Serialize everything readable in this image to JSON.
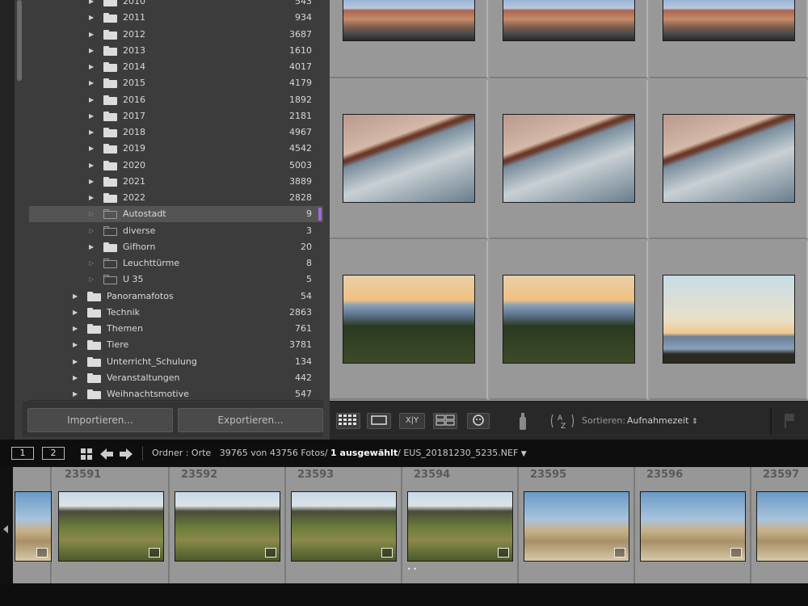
{
  "folder_panel": {
    "folders": [
      {
        "name": "2010",
        "count": "543",
        "level": 2,
        "expandable": true,
        "filled": true
      },
      {
        "name": "2011",
        "count": "934",
        "level": 2,
        "expandable": true,
        "filled": true
      },
      {
        "name": "2012",
        "count": "3687",
        "level": 2,
        "expandable": true,
        "filled": true
      },
      {
        "name": "2013",
        "count": "1610",
        "level": 2,
        "expandable": true,
        "filled": true
      },
      {
        "name": "2014",
        "count": "4017",
        "level": 2,
        "expandable": true,
        "filled": true
      },
      {
        "name": "2015",
        "count": "4179",
        "level": 2,
        "expandable": true,
        "filled": true
      },
      {
        "name": "2016",
        "count": "1892",
        "level": 2,
        "expandable": true,
        "filled": true
      },
      {
        "name": "2017",
        "count": "2181",
        "level": 2,
        "expandable": true,
        "filled": true
      },
      {
        "name": "2018",
        "count": "4967",
        "level": 2,
        "expandable": true,
        "filled": true
      },
      {
        "name": "2019",
        "count": "4542",
        "level": 2,
        "expandable": true,
        "filled": true
      },
      {
        "name": "2020",
        "count": "5003",
        "level": 2,
        "expandable": true,
        "filled": true
      },
      {
        "name": "2021",
        "count": "3889",
        "level": 2,
        "expandable": true,
        "filled": true
      },
      {
        "name": "2022",
        "count": "2828",
        "level": 2,
        "expandable": true,
        "filled": true
      },
      {
        "name": "Autostadt",
        "count": "9",
        "level": 2,
        "expandable": false,
        "filled": false,
        "selected": true
      },
      {
        "name": "diverse",
        "count": "3",
        "level": 2,
        "expandable": false,
        "filled": false
      },
      {
        "name": "Gifhorn",
        "count": "20",
        "level": 2,
        "expandable": true,
        "filled": true
      },
      {
        "name": "Leuchttürme",
        "count": "8",
        "level": 2,
        "expandable": false,
        "filled": false
      },
      {
        "name": "U 35",
        "count": "5",
        "level": 2,
        "expandable": false,
        "filled": false
      },
      {
        "name": "Panoramafotos",
        "count": "54",
        "level": 1,
        "expandable": true,
        "filled": true
      },
      {
        "name": "Technik",
        "count": "2863",
        "level": 1,
        "expandable": true,
        "filled": true
      },
      {
        "name": "Themen",
        "count": "761",
        "level": 1,
        "expandable": true,
        "filled": true
      },
      {
        "name": "Tiere",
        "count": "3781",
        "level": 1,
        "expandable": true,
        "filled": true
      },
      {
        "name": "Unterricht_Schulung",
        "count": "134",
        "level": 1,
        "expandable": true,
        "filled": true
      },
      {
        "name": "Veranstaltungen",
        "count": "442",
        "level": 1,
        "expandable": true,
        "filled": true
      },
      {
        "name": "Weihnachtsmotive",
        "count": "547",
        "level": 1,
        "expandable": true,
        "filled": true
      }
    ],
    "import_label": "Importieren...",
    "export_label": "Exportieren..."
  },
  "toolbar": {
    "sort_label": "Sortieren:",
    "sort_value": "Aufnahmezeit",
    "compare_label": "X|Y"
  },
  "filmstrip_header": {
    "view1": "1",
    "view2": "2",
    "source": "Ordner : Orte",
    "photo_count": "39765 von 43756 Fotos/",
    "selected": "1 ausgewählt",
    "filename": "/ EUS_20181230_5235.NEF"
  },
  "filmstrip": {
    "items": [
      {
        "number": "23591"
      },
      {
        "number": "23592"
      },
      {
        "number": "23593"
      },
      {
        "number": "23594"
      },
      {
        "number": "23595"
      },
      {
        "number": "23596"
      },
      {
        "number": "23597"
      }
    ]
  }
}
